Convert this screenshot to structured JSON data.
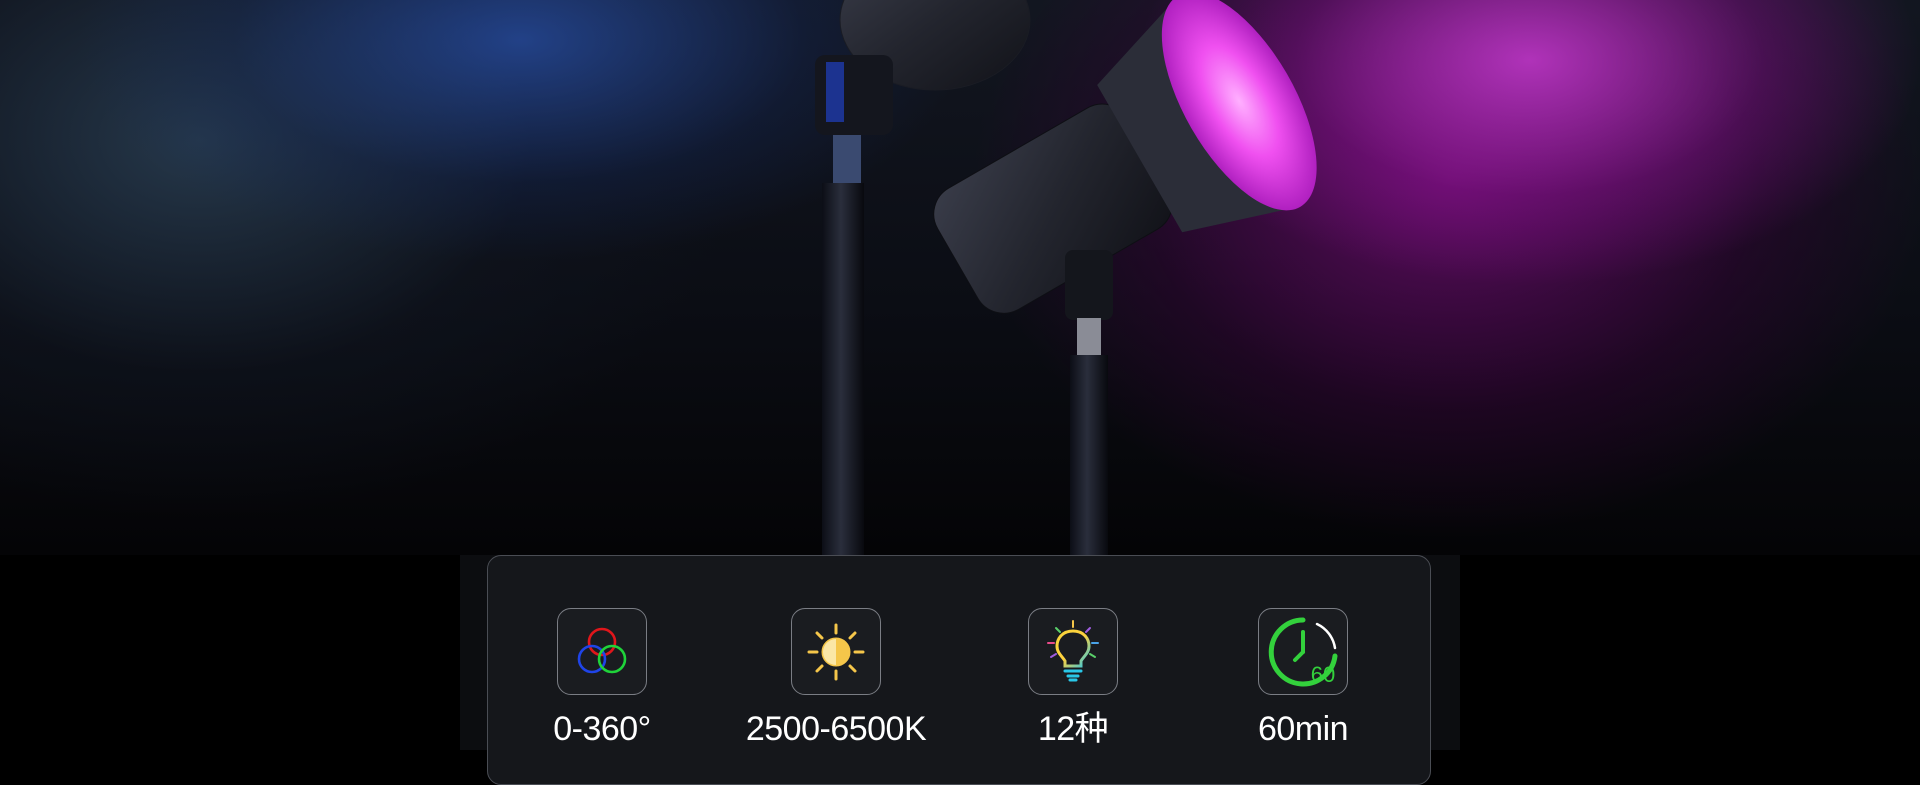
{
  "hero": {
    "image": "product-lights-hero",
    "accent_colors": {
      "magenta": "#e040e8",
      "blue": "#2a4fa8"
    }
  },
  "features": [
    {
      "icon": "rgb-circles-icon",
      "label": "0-360°"
    },
    {
      "icon": "sun-half-icon",
      "label": "2500-6500K"
    },
    {
      "icon": "lightbulb-icon",
      "label": "12种"
    },
    {
      "icon": "timer-60-icon",
      "label": "60min",
      "icon_text": "60"
    }
  ]
}
